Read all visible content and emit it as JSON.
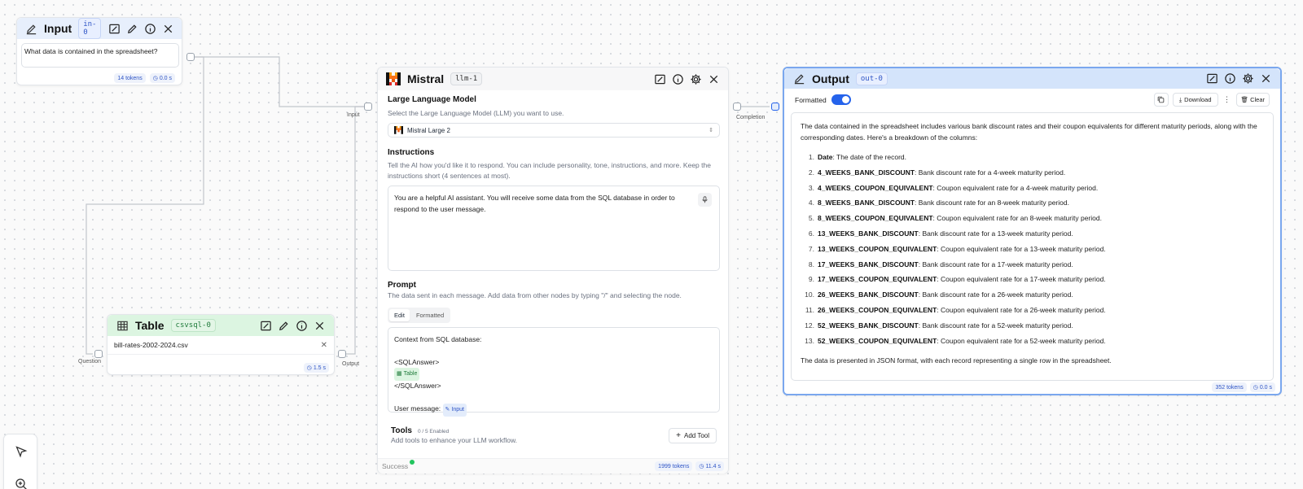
{
  "input_node": {
    "title": "Input",
    "tag": "in-0",
    "text": "What data is contained in the spreadsheet?",
    "tokens": "14 tokens",
    "time": "0.0 s"
  },
  "table_node": {
    "title": "Table",
    "tag": "csvsql-0",
    "file": "bill-rates-2002-2024.csv",
    "time": "1.5 s",
    "question_label": "Question",
    "output_label": "Output"
  },
  "mistral_node": {
    "title": "Mistral",
    "tag": "llm-1",
    "input_label": "Input",
    "completion_label": "Completion",
    "llm_title": "Large Language Model",
    "llm_desc": "Select the Large Language Model (LLM) you want to use.",
    "model": "Mistral Large 2",
    "instructions_title": "Instructions",
    "instructions_desc": "Tell the AI how you'd like it to respond. You can include personality, tone, instructions, and more. Keep the instructions short (4 sentences at most).",
    "instructions_text": "You are a helpful AI assistant. You will receive some data from the SQL database in order to respond to the user message.",
    "prompt_title": "Prompt",
    "prompt_desc": "The data sent in each message. Add data from other nodes by typing \"/\" and selecting the node.",
    "tab_edit": "Edit",
    "tab_formatted": "Formatted",
    "prompt_line1": "Context from SQL database:",
    "prompt_line2": "<SQLAnswer>",
    "prompt_chip_table": "Table",
    "prompt_line3": "</SQLAnswer>",
    "prompt_line4": "User message:",
    "prompt_chip_input": "Input",
    "tools_title": "Tools",
    "tools_count": "0 / 5 Enabled",
    "tools_desc": "Add tools to enhance your LLM workflow.",
    "add_tool": "Add Tool",
    "status": "Success",
    "tokens": "1999 tokens",
    "time": "11.4 s"
  },
  "output_node": {
    "title": "Output",
    "tag": "out-0",
    "formatted_label": "Formatted",
    "formatted_on": true,
    "download": "Download",
    "clear": "Clear",
    "intro": "The data contained in the spreadsheet includes various bank discount rates and their coupon equivalents for different maturity periods, along with the corresponding dates. Here's a breakdown of the columns:",
    "columns": [
      {
        "num": "1.",
        "name": "Date",
        "desc": ": The date of the record."
      },
      {
        "num": "2.",
        "name": "4_WEEKS_BANK_DISCOUNT",
        "desc": ": Bank discount rate for a 4-week maturity period."
      },
      {
        "num": "3.",
        "name": "4_WEEKS_COUPON_EQUIVALENT",
        "desc": ": Coupon equivalent rate for a 4-week maturity period."
      },
      {
        "num": "4.",
        "name": "8_WEEKS_BANK_DISCOUNT",
        "desc": ": Bank discount rate for an 8-week maturity period."
      },
      {
        "num": "5.",
        "name": "8_WEEKS_COUPON_EQUIVALENT",
        "desc": ": Coupon equivalent rate for an 8-week maturity period."
      },
      {
        "num": "6.",
        "name": "13_WEEKS_BANK_DISCOUNT",
        "desc": ": Bank discount rate for a 13-week maturity period."
      },
      {
        "num": "7.",
        "name": "13_WEEKS_COUPON_EQUIVALENT",
        "desc": ": Coupon equivalent rate for a 13-week maturity period."
      },
      {
        "num": "8.",
        "name": "17_WEEKS_BANK_DISCOUNT",
        "desc": ": Bank discount rate for a 17-week maturity period."
      },
      {
        "num": "9.",
        "name": "17_WEEKS_COUPON_EQUIVALENT",
        "desc": ": Coupon equivalent rate for a 17-week maturity period."
      },
      {
        "num": "10.",
        "name": "26_WEEKS_BANK_DISCOUNT",
        "desc": ": Bank discount rate for a 26-week maturity period."
      },
      {
        "num": "11.",
        "name": "26_WEEKS_COUPON_EQUIVALENT",
        "desc": ": Coupon equivalent rate for a 26-week maturity period."
      },
      {
        "num": "12.",
        "name": "52_WEEKS_BANK_DISCOUNT",
        "desc": ": Bank discount rate for a 52-week maturity period."
      },
      {
        "num": "13.",
        "name": "52_WEEKS_COUPON_EQUIVALENT",
        "desc": ": Coupon equivalent rate for a 52-week maturity period."
      }
    ],
    "outro": "The data is presented in JSON format, with each record representing a single row in the spreadsheet.",
    "tokens": "352 tokens",
    "time": "0.0 s"
  },
  "colors": {
    "accent": "#2563eb",
    "input_header": "#e7effc",
    "table_header": "#dcf5e1",
    "output_header": "#d4e4fb",
    "success": "#22c55e",
    "mistral_orange": "#f97316"
  }
}
